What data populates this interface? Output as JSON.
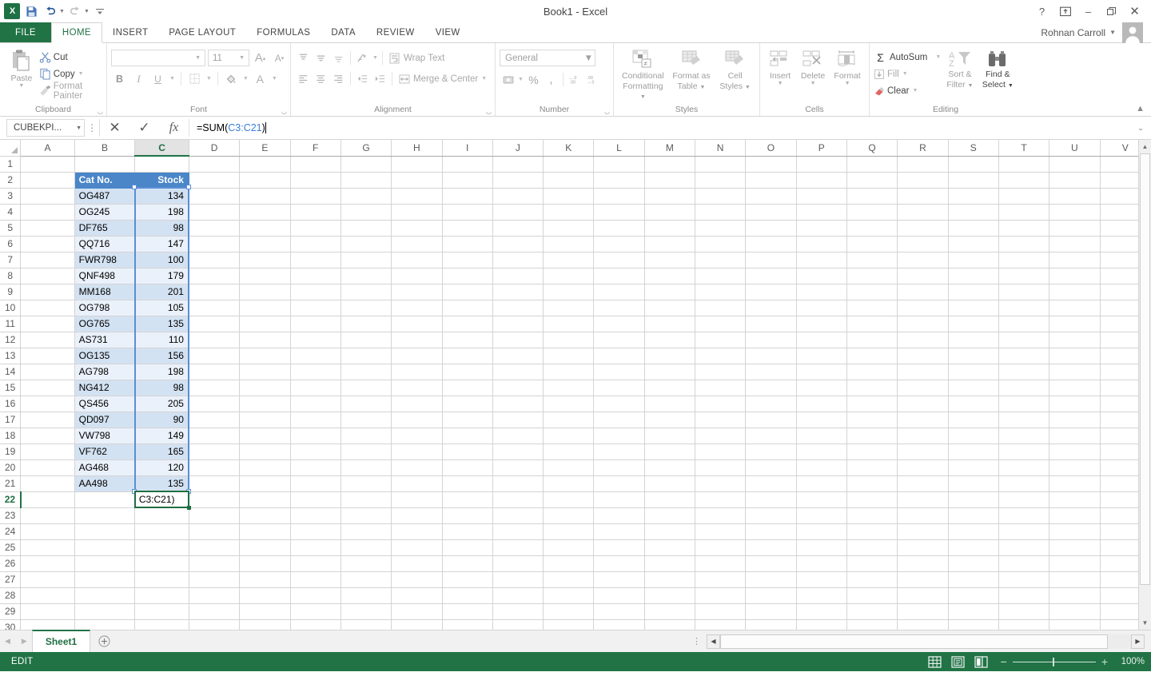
{
  "window": {
    "title": "Book1 - Excel",
    "user_name": "Rohnan Carroll",
    "help_icon": "?",
    "ribbon_display_icon": "ribbon-display-options",
    "minimize_icon": "–",
    "restore_icon": "❐",
    "close_icon": "✕"
  },
  "quick_access": {
    "logo": "X",
    "save_label": "Save",
    "undo_label": "Undo",
    "redo_label": "Redo",
    "customize_label": "Customize Quick Access Toolbar"
  },
  "tabs": {
    "file": "FILE",
    "items": [
      "HOME",
      "INSERT",
      "PAGE LAYOUT",
      "FORMULAS",
      "DATA",
      "REVIEW",
      "VIEW"
    ],
    "active": "HOME"
  },
  "ribbon": {
    "clipboard": {
      "label": "Clipboard",
      "paste": "Paste",
      "cut": "Cut",
      "copy": "Copy",
      "format_painter": "Format Painter"
    },
    "font": {
      "label": "Font",
      "font_name": "",
      "font_name_placeholder": "",
      "font_size": "11",
      "grow_font": "A",
      "shrink_font": "A",
      "bold": "B",
      "italic": "I",
      "underline": "U",
      "borders": "Borders",
      "fill_color": "Fill Color",
      "font_color": "A"
    },
    "alignment": {
      "label": "Alignment",
      "wrap_text": "Wrap Text",
      "merge_center": "Merge & Center",
      "orientation": "Orientation",
      "decrease_indent": "Decrease Indent",
      "increase_indent": "Increase Indent"
    },
    "number": {
      "label": "Number",
      "format": "General",
      "accounting": "Accounting Number Format",
      "percent": "%",
      "comma": ",",
      "increase_decimal": "Increase Decimal",
      "decrease_decimal": "Decrease Decimal"
    },
    "styles": {
      "label": "Styles",
      "conditional_formatting": "Conditional\nFormatting",
      "conditional_formatting_l1": "Conditional",
      "conditional_formatting_l2": "Formatting",
      "format_as_table_l1": "Format as",
      "format_as_table_l2": "Table",
      "cell_styles_l1": "Cell",
      "cell_styles_l2": "Styles"
    },
    "cells": {
      "label": "Cells",
      "insert": "Insert",
      "delete": "Delete",
      "format": "Format"
    },
    "editing": {
      "label": "Editing",
      "autosum": "AutoSum",
      "fill": "Fill",
      "clear": "Clear",
      "sort_filter_l1": "Sort &",
      "sort_filter_l2": "Filter",
      "find_select_l1": "Find &",
      "find_select_l2": "Select"
    },
    "collapse_icon": "⌃"
  },
  "formula_bar": {
    "name_box": "CUBEKPI...",
    "cancel_icon": "✕",
    "enter_icon": "✓",
    "function_icon": "fx",
    "formula_prefix": "=SUM(",
    "formula_ref": "C3:C21",
    "formula_suffix": ")",
    "expand_icon": "⌄"
  },
  "sheet": {
    "columns": [
      "A",
      "B",
      "C",
      "D",
      "E",
      "F",
      "G",
      "H",
      "I",
      "J",
      "K",
      "L",
      "M",
      "N",
      "O",
      "P",
      "Q",
      "R",
      "S",
      "T",
      "U",
      "V"
    ],
    "selected_column": "C",
    "rows": [
      1,
      2,
      3,
      4,
      5,
      6,
      7,
      8,
      9,
      10,
      11,
      12,
      13,
      14,
      15,
      16,
      17,
      18,
      19,
      20,
      21,
      22,
      23,
      24,
      25,
      26,
      27,
      28,
      29,
      30
    ],
    "selected_row": 22,
    "headers": {
      "b": "Cat No.",
      "c": "Stock"
    },
    "data": [
      {
        "row": 3,
        "cat_no": "OG487",
        "stock": "134"
      },
      {
        "row": 4,
        "cat_no": "OG245",
        "stock": "198"
      },
      {
        "row": 5,
        "cat_no": "DF765",
        "stock": "98"
      },
      {
        "row": 6,
        "cat_no": "QQ716",
        "stock": "147"
      },
      {
        "row": 7,
        "cat_no": "FWR798",
        "stock": "100"
      },
      {
        "row": 8,
        "cat_no": "QNF498",
        "stock": "179"
      },
      {
        "row": 9,
        "cat_no": "MM168",
        "stock": "201"
      },
      {
        "row": 10,
        "cat_no": "OG798",
        "stock": "105"
      },
      {
        "row": 11,
        "cat_no": "OG765",
        "stock": "135"
      },
      {
        "row": 12,
        "cat_no": "AS731",
        "stock": "110"
      },
      {
        "row": 13,
        "cat_no": "OG135",
        "stock": "156"
      },
      {
        "row": 14,
        "cat_no": "AG798",
        "stock": "198"
      },
      {
        "row": 15,
        "cat_no": "NG412",
        "stock": "98"
      },
      {
        "row": 16,
        "cat_no": "QS456",
        "stock": "205"
      },
      {
        "row": 17,
        "cat_no": "QD097",
        "stock": "90"
      },
      {
        "row": 18,
        "cat_no": "VW798",
        "stock": "149"
      },
      {
        "row": 19,
        "cat_no": "VF762",
        "stock": "165"
      },
      {
        "row": 20,
        "cat_no": "AG468",
        "stock": "120"
      },
      {
        "row": 21,
        "cat_no": "AA498",
        "stock": "135"
      }
    ],
    "active_cell_text": "C3:C21)",
    "colors": {
      "header_fill": "#4a86c8",
      "band_dark": "#d3e2f2",
      "band_light": "#eaf1fa",
      "selection_border": "#5b8ed6",
      "active_border": "#1f6e43"
    }
  },
  "sheet_tabs": {
    "prev_icon": "◀",
    "next_icon": "▶",
    "sheets": [
      "Sheet1"
    ],
    "active_sheet": "Sheet1",
    "add_sheet_icon": "+"
  },
  "status_bar": {
    "mode": "EDIT",
    "view_normal": "Normal",
    "view_page_layout": "Page Layout",
    "view_page_break": "Page Break Preview",
    "zoom_out": "−",
    "zoom_in": "+",
    "zoom_level": "100%"
  }
}
